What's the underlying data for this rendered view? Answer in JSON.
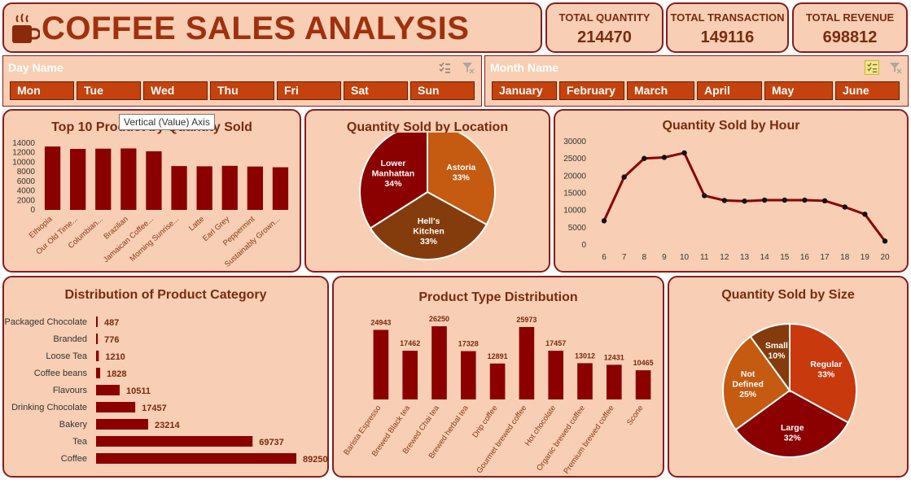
{
  "header": {
    "title": "COFFEE SALES ANALYSIS",
    "cup_icon": "coffee-cup-icon"
  },
  "kpis": [
    {
      "label": "TOTAL QUANTITY",
      "value": "214470"
    },
    {
      "label": "TOTAL TRANSACTION",
      "value": "149116"
    },
    {
      "label": "TOTAL REVENUE",
      "value": "698812"
    }
  ],
  "day_slicer": {
    "label": "Day Name",
    "items": [
      "Mon",
      "Tue",
      "Wed",
      "Thu",
      "Fri",
      "Sat",
      "Sun"
    ]
  },
  "month_slicer": {
    "label": "Month Name",
    "items": [
      "January",
      "February",
      "March",
      "April",
      "May",
      "June"
    ]
  },
  "tooltip": "Vertical (Value) Axis",
  "colors": {
    "bg": "#f8cfb4",
    "border": "#8b1a1a",
    "dark_red": "#8b0000",
    "orange": "#c4420d",
    "slicer_btn": "#c4420d"
  },
  "chart_data": [
    {
      "id": "top10",
      "type": "bar",
      "title": "Top 10 Product by Quantity Sold",
      "categories": [
        "Ethiopia",
        "Our Old Time...",
        "Columbian...",
        "Brazilian",
        "Jamaican Coffee...",
        "Morning Sunrise...",
        "Latte",
        "Earl Grey",
        "Peppermint",
        "Sustainably Grown..."
      ],
      "values": [
        13300,
        12800,
        12850,
        12900,
        12300,
        9200,
        9150,
        9250,
        9100,
        8950
      ],
      "yticks": [
        0,
        2000,
        4000,
        6000,
        8000,
        10000,
        12000,
        14000
      ],
      "ylim": [
        0,
        14000
      ]
    },
    {
      "id": "location",
      "type": "pie",
      "title": "Quantity Sold by Location",
      "slices": [
        {
          "label": "Astoria",
          "pct": "33%",
          "value": 33,
          "color": "#c55a11"
        },
        {
          "label": "Hell's Kitchen",
          "pct": "33%",
          "value": 33,
          "color": "#843c0c"
        },
        {
          "label": "Lower Manhattan",
          "pct": "34%",
          "value": 34,
          "color": "#8b0000"
        }
      ]
    },
    {
      "id": "hour",
      "type": "line",
      "title": "Quantity Sold by Hour",
      "x": [
        6,
        7,
        8,
        9,
        10,
        11,
        12,
        13,
        14,
        15,
        16,
        17,
        18,
        19,
        20
      ],
      "values": [
        7000,
        19700,
        25100,
        25400,
        26700,
        14300,
        12900,
        12700,
        13000,
        13000,
        13000,
        12800,
        11000,
        8900,
        1100
      ],
      "yticks": [
        0,
        5000,
        10000,
        15000,
        20000,
        25000,
        30000
      ],
      "ylim": [
        0,
        30000
      ]
    },
    {
      "id": "category",
      "type": "bar",
      "title": "Distribution of Product Category",
      "categories": [
        "Packaged Chocolate",
        "Branded",
        "Loose Tea",
        "Coffee beans",
        "Flavours",
        "Drinking Chocolate",
        "Bakery",
        "Tea",
        "Coffee"
      ],
      "values": [
        487,
        776,
        1210,
        1828,
        10511,
        17457,
        23214,
        69737,
        89250
      ]
    },
    {
      "id": "producttype",
      "type": "bar",
      "title": "Product Type Distribution",
      "categories": [
        "Barista Espresso",
        "Brewed Black tea",
        "Brewed Chai tea",
        "Brewed herbal tea",
        "Drip coffee",
        "Gourmet brewed coffee",
        "Hot chocolate",
        "Organic brewed coffee",
        "Premium brewed coffee",
        "Scone"
      ],
      "values": [
        24943,
        17462,
        26250,
        17328,
        12891,
        25973,
        17457,
        13012,
        12431,
        10465
      ]
    },
    {
      "id": "size",
      "type": "pie",
      "title": "Quantity Sold by Size",
      "slices": [
        {
          "label": "Regular",
          "pct": "33%",
          "value": 33,
          "color": "#c8390e"
        },
        {
          "label": "Large",
          "pct": "32%",
          "value": 32,
          "color": "#8b0000"
        },
        {
          "label": "Not Defined",
          "pct": "25%",
          "value": 25,
          "color": "#c55a11"
        },
        {
          "label": "Small",
          "pct": "10%",
          "value": 10,
          "color": "#843c0c"
        }
      ]
    }
  ]
}
